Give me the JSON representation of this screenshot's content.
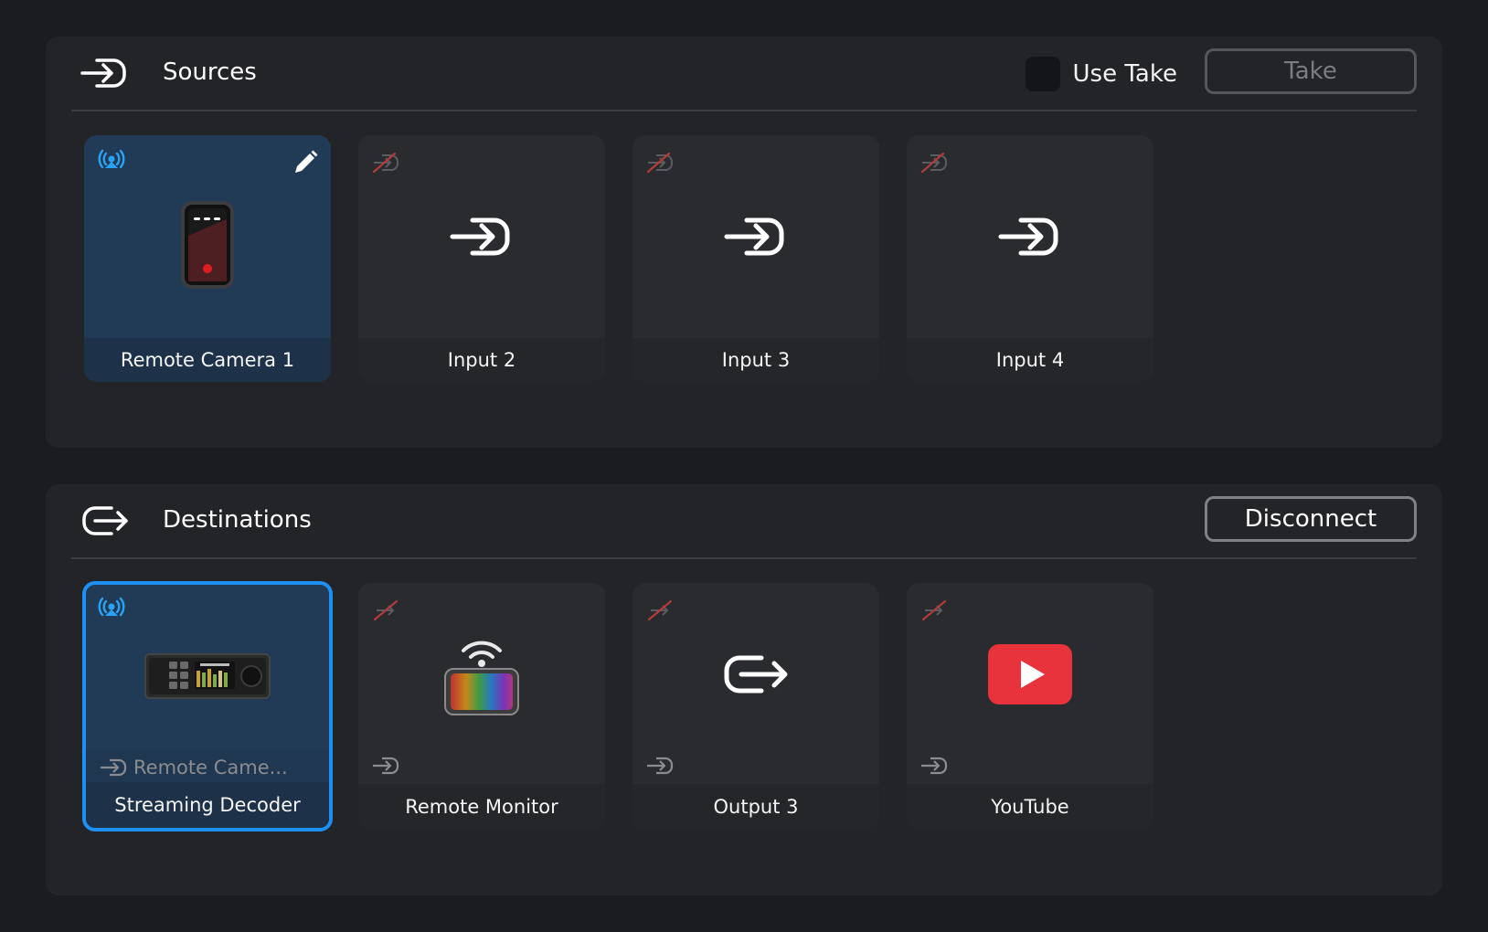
{
  "sources": {
    "title": "Sources",
    "use_take_label": "Use Take",
    "take_label": "Take",
    "tiles": [
      {
        "label": "Remote Camera 1",
        "icon": "remote-camera-device-icon",
        "status": "connected",
        "editable": true
      },
      {
        "label": "Input 2",
        "icon": "input-icon",
        "status": "disconnected"
      },
      {
        "label": "Input 3",
        "icon": "input-icon",
        "status": "disconnected"
      },
      {
        "label": "Input 4",
        "icon": "input-icon",
        "status": "disconnected"
      }
    ]
  },
  "destinations": {
    "title": "Destinations",
    "disconnect_label": "Disconnect",
    "tiles": [
      {
        "label": "Streaming Decoder",
        "icon": "streaming-decoder-device-icon",
        "status": "connected",
        "route": "Remote Came...",
        "selected": true
      },
      {
        "label": "Remote Monitor",
        "icon": "remote-monitor-icon",
        "status": "disconnected",
        "route": ""
      },
      {
        "label": "Output 3",
        "icon": "output-icon",
        "status": "disconnected",
        "route": ""
      },
      {
        "label": "YouTube",
        "icon": "youtube-icon",
        "status": "disconnected",
        "route": ""
      }
    ]
  },
  "colors": {
    "accent": "#1e8ff3",
    "active_tile": "#213b56",
    "youtube_red": "#e8333c",
    "disconnected_red": "#c0392b"
  }
}
